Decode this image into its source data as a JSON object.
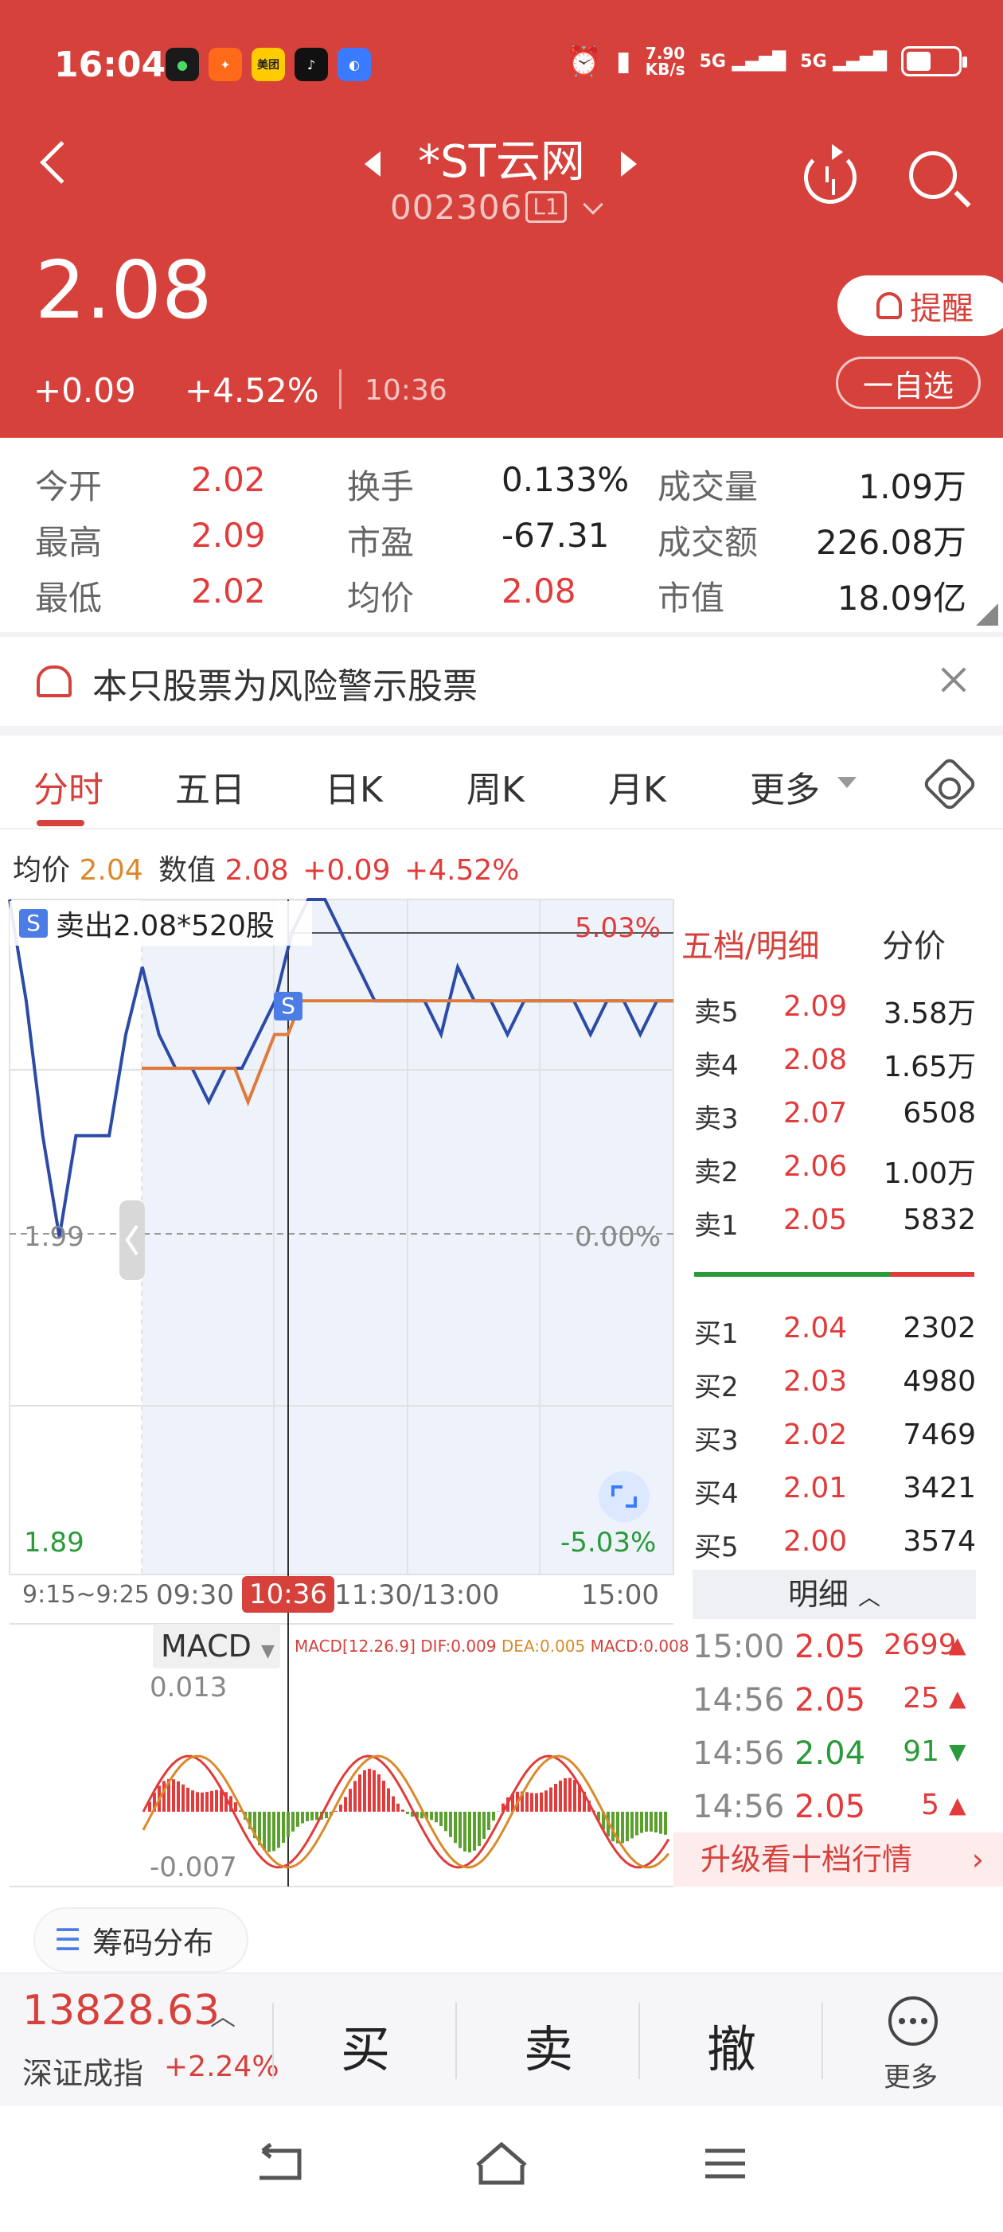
{
  "status_bar": {
    "time": "16:04",
    "net_speed": "7.90",
    "net_unit": "KB/s",
    "sig1": "5G",
    "sig2": "5G",
    "app_icons": [
      "app-green-icon",
      "app-orange-icon",
      "meituan-icon",
      "tiktok-icon",
      "browser-icon"
    ],
    "meituan_label": "美团"
  },
  "header": {
    "name": "*ST云网",
    "code": "002306",
    "level": "L1",
    "price": "2.08",
    "change": "+0.09",
    "change_pct": "+4.52%",
    "time": "10:36",
    "remind_label": "提醒",
    "watch_label": "一自选",
    "bg_color": "#d6413c"
  },
  "stats": [
    {
      "label": "今开",
      "value": "2.02",
      "color": "red"
    },
    {
      "label": "换手",
      "value": "0.133%",
      "color": "black"
    },
    {
      "label": "成交量",
      "value": "1.09万",
      "color": "black"
    },
    {
      "label": "最高",
      "value": "2.09",
      "color": "red"
    },
    {
      "label": "市盈",
      "value": "-67.31",
      "color": "black"
    },
    {
      "label": "成交额",
      "value": "226.08万",
      "color": "black"
    },
    {
      "label": "最低",
      "value": "2.02",
      "color": "red"
    },
    {
      "label": "均价",
      "value": "2.08",
      "color": "red"
    },
    {
      "label": "市值",
      "value": "18.09亿",
      "color": "black"
    }
  ],
  "warning": {
    "text": "本只股票为风险警示股票"
  },
  "tabs": [
    "分时",
    "五日",
    "日K",
    "周K",
    "月K",
    "更多"
  ],
  "chart_info": {
    "avg_label": "均价",
    "avg_value": "2.04",
    "val_label": "数值",
    "val_value": "2.08",
    "val_change": "+0.09",
    "val_pct": "+4.52%",
    "trade_marker": "S",
    "trade_tag": "卖出2.08*520股"
  },
  "chart_data": {
    "type": "line",
    "ylim": [
      1.89,
      2.09
    ],
    "y_left_ticks": [
      "1.99",
      "1.89"
    ],
    "y_right_ticks": [
      "5.03%",
      "0.00%",
      "-5.03%"
    ],
    "x_ticks": [
      "9:15~9:25",
      "09:30",
      "10:36",
      "11:30/13:00",
      "15:00"
    ],
    "series": [
      {
        "values": [
          2.09,
          2.06,
          2.02,
          1.99,
          2.02,
          2.02,
          2.02,
          2.05,
          2.07,
          2.05,
          2.04,
          2.04,
          2.03,
          2.04,
          2.04,
          2.05,
          2.06,
          2.08,
          2.09,
          2.09,
          2.08,
          2.07,
          2.06,
          2.06,
          2.06,
          2.06,
          2.05,
          2.07,
          2.06,
          2.06,
          2.05,
          2.06,
          2.06,
          2.06,
          2.06,
          2.05,
          2.06,
          2.06,
          2.05,
          2.06,
          2.06
        ]
      },
      {
        "values": [
          2.04,
          2.04,
          2.04,
          2.04,
          2.04,
          2.04,
          2.04,
          2.04,
          2.03,
          2.04,
          2.05,
          2.05,
          2.06,
          2.06,
          2.06,
          2.06,
          2.06,
          2.06,
          2.06,
          2.06,
          2.06,
          2.06,
          2.06,
          2.06,
          2.06,
          2.06,
          2.06,
          2.06,
          2.06,
          2.06,
          2.06,
          2.06,
          2.06,
          2.06,
          2.06,
          2.06,
          2.06,
          2.06,
          2.06,
          2.06,
          2.06
        ]
      }
    ],
    "line_colors": [
      "#2c4aa8",
      "#e07a3a"
    ]
  },
  "macd": {
    "selector": "MACD",
    "params": "MACD[12.26.9]",
    "dif": "DIF:0.009",
    "dea": "DEA:0.005",
    "macd": "MACD:0.008",
    "top": "0.013",
    "bottom": "-0.007"
  },
  "orderbook": {
    "tab": "五档/明细",
    "alt_tab": "分价",
    "sells": [
      {
        "label": "卖5",
        "price": "2.09",
        "vol": "3.58万"
      },
      {
        "label": "卖4",
        "price": "2.08",
        "vol": "1.65万"
      },
      {
        "label": "卖3",
        "price": "2.07",
        "vol": "6508"
      },
      {
        "label": "卖2",
        "price": "2.06",
        "vol": "1.00万"
      },
      {
        "label": "卖1",
        "price": "2.05",
        "vol": "5832"
      }
    ],
    "buys": [
      {
        "label": "买1",
        "price": "2.04",
        "vol": "2302"
      },
      {
        "label": "买2",
        "price": "2.03",
        "vol": "4980"
      },
      {
        "label": "买3",
        "price": "2.02",
        "vol": "7469"
      },
      {
        "label": "买4",
        "price": "2.01",
        "vol": "3421"
      },
      {
        "label": "买5",
        "price": "2.00",
        "vol": "3574"
      }
    ],
    "detail_label": "明细",
    "details": [
      {
        "time": "15:00",
        "price": "2.05",
        "vol": "2699",
        "dir": "up"
      },
      {
        "time": "14:56",
        "price": "2.05",
        "vol": "25",
        "dir": "up"
      },
      {
        "time": "14:56",
        "price": "2.04",
        "vol": "91",
        "dir": "down"
      },
      {
        "time": "14:56",
        "price": "2.05",
        "vol": "5",
        "dir": "up"
      }
    ],
    "upgrade": "升级看十档行情"
  },
  "chip_label": "筹码分布",
  "bottom": {
    "index_value": "13828.63",
    "index_name": "深证成指",
    "index_pct": "+2.24%",
    "buy": "买",
    "sell": "卖",
    "cancel": "撤",
    "more": "更多"
  }
}
